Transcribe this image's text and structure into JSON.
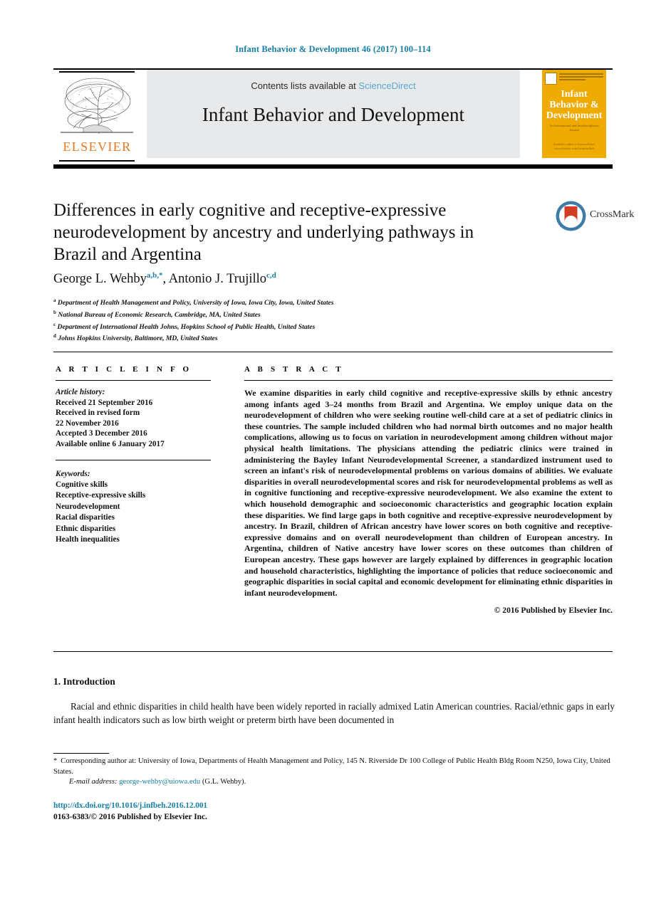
{
  "running_head": "Infant Behavior & Development 46 (2017) 100–114",
  "masthead": {
    "publisher_name": "ELSEVIER",
    "contents_prefix": "Contents lists available at ",
    "contents_link": "ScienceDirect",
    "journal_title": "Infant Behavior and Development",
    "cover": {
      "title_line1": "Infant",
      "title_line2": "Behavior &",
      "title_line3": "Development",
      "subtitle": "An International and Interdisciplinary Journal",
      "footer": "Available online at ScienceDirect www.elsevier.com/locate/infbeh"
    }
  },
  "article": {
    "title": "Differences in early cognitive and receptive-expressive neurodevelopment by ancestry and underlying pathways in Brazil and Argentina",
    "authors": [
      {
        "name": "George L. Wehby",
        "marks": "a,b,*"
      },
      {
        "name": "Antonio J. Trujillo",
        "marks": "c,d"
      }
    ],
    "affiliations": [
      {
        "mark": "a",
        "text": "Department of Health Management and Policy, University of Iowa, Iowa City, Iowa, United States"
      },
      {
        "mark": "b",
        "text": "National Bureau of Economic Research, Cambridge, MA, United States"
      },
      {
        "mark": "c",
        "text": "Department of International Health Johns, Hopkins School of Public Health, United States"
      },
      {
        "mark": "d",
        "text": "Johns Hopkins University, Baltimore, MD, United States"
      }
    ],
    "crossmark_label": "CrossMark"
  },
  "article_info": {
    "heading": "A R T I C L E   I N F O",
    "history_label": "Article history:",
    "history": [
      "Received 21 September 2016",
      "Received in revised form",
      "22 November 2016",
      "Accepted 3 December 2016",
      "Available online 6 January 2017"
    ],
    "keywords_label": "Keywords:",
    "keywords": [
      "Cognitive skills",
      "Receptive-expressive skills",
      "Neurodevelopment",
      "Racial disparities",
      "Ethnic disparities",
      "Health inequalities"
    ]
  },
  "abstract": {
    "heading": "A B S T R A C T",
    "body": "We examine disparities in early child cognitive and receptive-expressive skills by ethnic ancestry among infants aged 3–24 months from Brazil and Argentina. We employ unique data on the neurodevelopment of children who were seeking routine well-child care at a set of pediatric clinics in these countries. The sample included children who had normal birth outcomes and no major health complications, allowing us to focus on variation in neurodevelopment among children without major physical health limitations. The physicians attending the pediatric clinics were trained in administering the Bayley Infant Neurodevelopmental Screener, a standardized instrument used to screen an infant's risk of neurodevelopmental problems on various domains of abilities. We evaluate disparities in overall neurodevelopmental scores and risk for neurodevelopmental problems as well as in cognitive functioning and receptive-expressive neurodevelopment. We also examine the extent to which household demographic and socioeconomic characteristics and geographic location explain these disparities. We find large gaps in both cognitive and receptive-expressive neurodevelopment by ancestry. In Brazil, children of African ancestry have lower scores on both cognitive and receptive-expressive domains and on overall neurodevelopment than children of European ancestry. In Argentina, children of Native ancestry have lower scores on these outcomes than children of European ancestry. These gaps however are largely explained by differences in geographic location and household characteristics, highlighting the importance of policies that reduce socioeconomic and geographic disparities in social capital and economic development for eliminating ethnic disparities in infant neurodevelopment.",
    "copyright": "© 2016 Published by Elsevier Inc."
  },
  "introduction": {
    "heading": "1.  Introduction",
    "body": "Racial and ethnic disparities in child health have been widely reported in racially admixed Latin American countries. Racial/ethnic gaps in early infant health indicators such as low birth weight or preterm birth have been documented in"
  },
  "footer": {
    "corresponding_marker": "*",
    "corresponding_text": "Corresponding author at: University of Iowa, Departments of Health Management and Policy, 145 N. Riverside Dr 100 College of Public Health Bldg Room N250, Iowa City, United States.",
    "email_label": "E-mail address:",
    "email": "george-wehby@uiowa.edu",
    "email_owner": "(G.L. Wehby).",
    "doi": "http://dx.doi.org/10.1016/j.infbeh.2016.12.001",
    "issn_line": "0163-6383/© 2016 Published by Elsevier Inc."
  },
  "colors": {
    "link": "#1a7fa8",
    "elsevier_orange": "#e87722",
    "banner_bg": "#e7e9ea",
    "cover_gold": "#f0ab00",
    "sciencedirect": "#5aa6d6"
  }
}
